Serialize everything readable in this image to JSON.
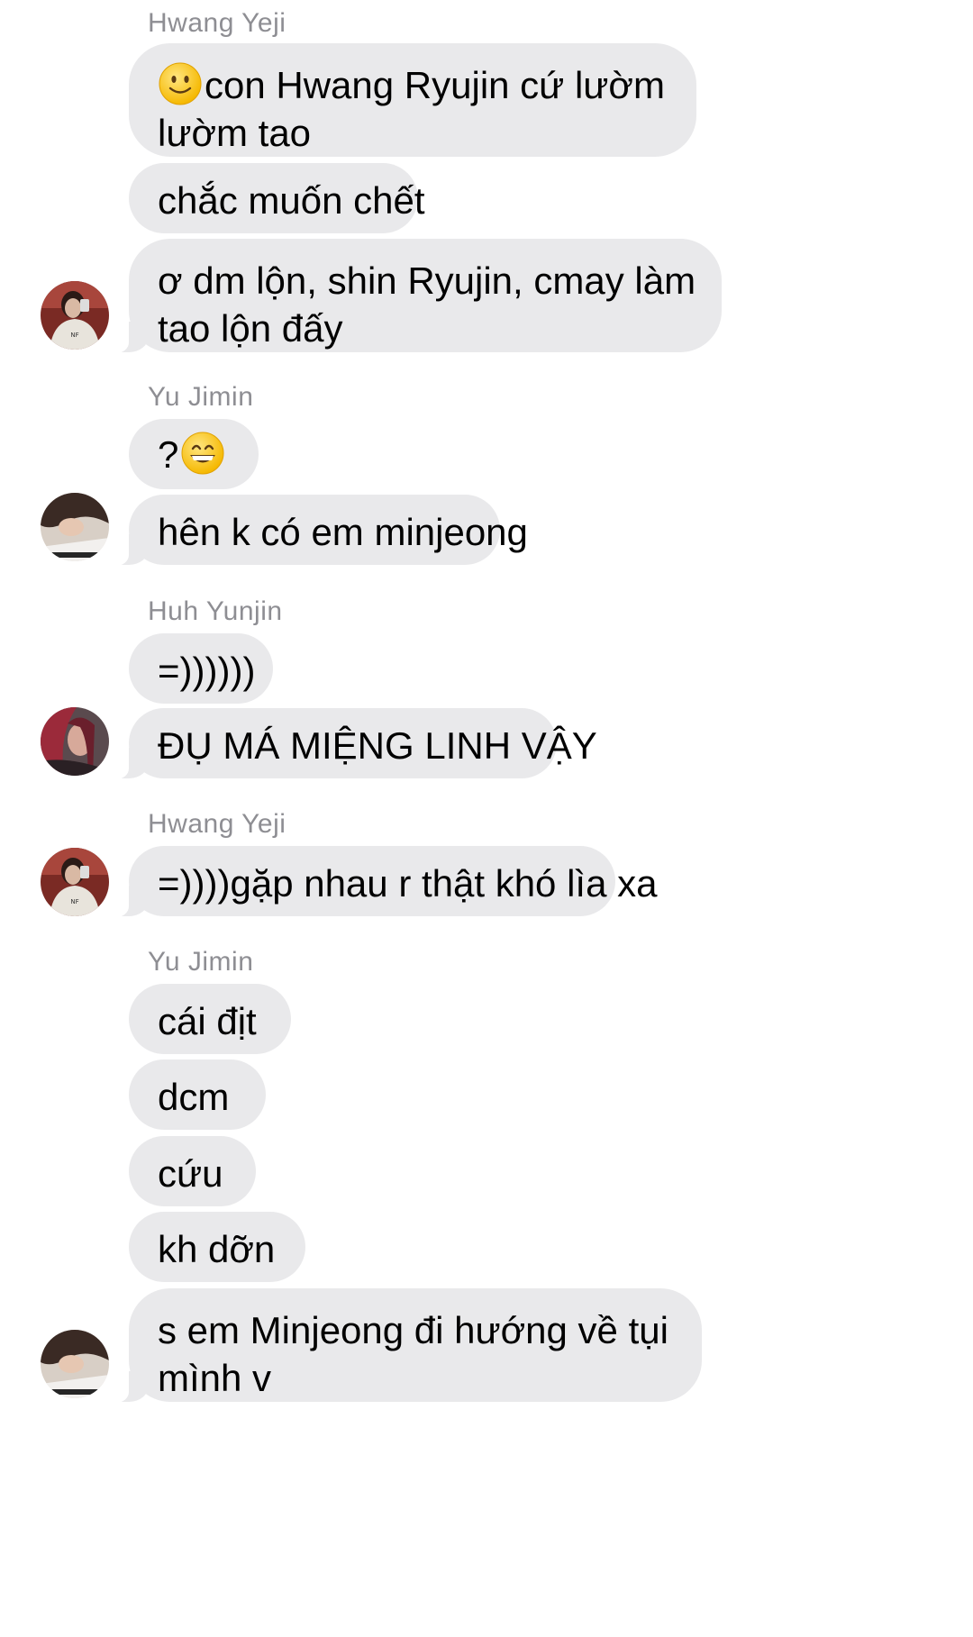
{
  "messages": [
    {
      "sender": "Hwang Yeji",
      "bubbles": [
        {
          "lines": [
            "con Hwang Ryujin cứ lườm",
            "lườm tao"
          ],
          "emoji": "slightly-smiling-face-icon"
        },
        {
          "lines": [
            "chắc muốn chết"
          ]
        },
        {
          "lines": [
            "ơ dm lộn, shin Ryujin, cmay làm",
            "tao lộn đấy"
          ]
        }
      ]
    },
    {
      "sender": "Yu Jimin",
      "bubbles": [
        {
          "lines": [
            "?"
          ],
          "emoji": "grinning-face-icon"
        },
        {
          "lines": [
            "hên k có em minjeong"
          ]
        }
      ]
    },
    {
      "sender": "Huh Yunjin",
      "bubbles": [
        {
          "lines": [
            "=))))))"
          ]
        },
        {
          "lines": [
            "ĐỤ MÁ MIỆNG LINH VẬY"
          ]
        }
      ]
    },
    {
      "sender": "Hwang Yeji",
      "bubbles": [
        {
          "lines": [
            "=))))gặp nhau r thật khó lìa xa"
          ]
        }
      ]
    },
    {
      "sender": "Yu Jimin",
      "bubbles": [
        {
          "lines": [
            "cái địt"
          ]
        },
        {
          "lines": [
            "dcm"
          ]
        },
        {
          "lines": [
            "cứu"
          ]
        },
        {
          "lines": [
            "kh dỡn"
          ]
        },
        {
          "lines": [
            "s em Minjeong đi hướng về tụi",
            "mình v"
          ]
        }
      ]
    }
  ],
  "colors": {
    "bubble": "#e9e9eb",
    "sender_name": "#8e8e93",
    "text": "#000000",
    "background": "#ffffff"
  }
}
